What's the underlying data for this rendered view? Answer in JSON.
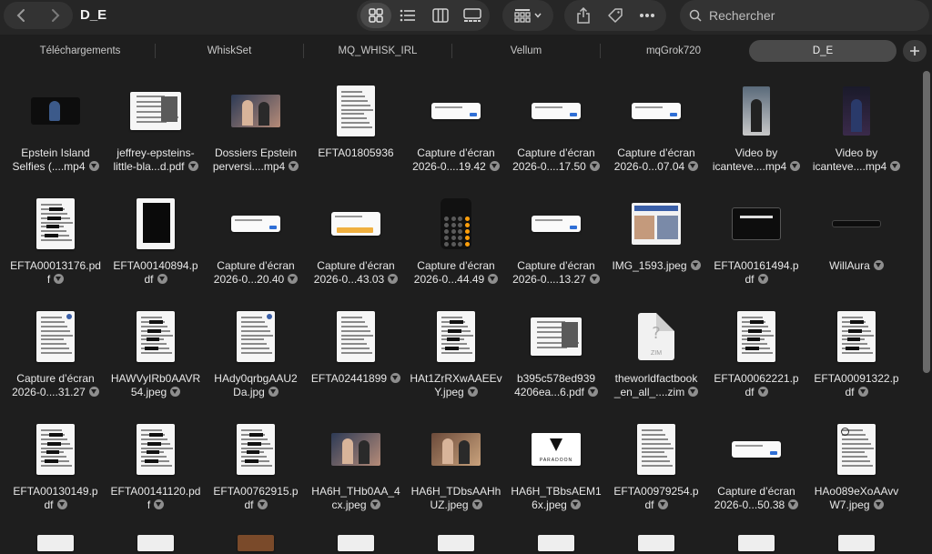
{
  "toolbar": {
    "title": "D_E",
    "search_placeholder": "Rechercher",
    "back_icon": "chevron-left-icon",
    "forward_icon": "chevron-right-icon",
    "views": [
      "icon-view",
      "list-view",
      "column-view",
      "gallery-view"
    ],
    "active_view": "icon-view"
  },
  "tabs": [
    {
      "label": "Téléchargements",
      "active": false
    },
    {
      "label": "WhiskSet",
      "active": false
    },
    {
      "label": "MQ_WHISK_IRL",
      "active": false
    },
    {
      "label": "Vellum",
      "active": false
    },
    {
      "label": "mqGrok720",
      "active": false
    },
    {
      "label": "D_E",
      "active": true
    }
  ],
  "rows": [
    [
      {
        "l1": "Epstein Island",
        "l2": "Selfies (....mp4",
        "cloud": true,
        "kind": "dark-photo"
      },
      {
        "l1": "jeffrey-epsteins-",
        "l2": "little-bla...d.pdf",
        "cloud": true,
        "kind": "doc-wide"
      },
      {
        "l1": "Dossiers Epstein",
        "l2": "perversi....mp4",
        "cloud": true,
        "kind": "photo-people"
      },
      {
        "l1": "EFTA01805936",
        "l2": "",
        "cloud": false,
        "kind": "doc"
      },
      {
        "l1": "Capture d’écran",
        "l2": "2026-0....19.42",
        "cloud": true,
        "kind": "shot"
      },
      {
        "l1": "Capture d’écran",
        "l2": "2026-0....17.50",
        "cloud": true,
        "kind": "shot"
      },
      {
        "l1": "Capture d’écran",
        "l2": "2026-0...07.04",
        "cloud": true,
        "kind": "shot"
      },
      {
        "l1": "Video by",
        "l2": "icanteve....mp4",
        "cloud": true,
        "kind": "phone-video"
      },
      {
        "l1": "Video by",
        "l2": "icanteve....mp4",
        "cloud": true,
        "kind": "phone-video-dark"
      }
    ],
    [
      {
        "l1": "EFTA00013176.pd",
        "l2": "f",
        "cloud": true,
        "kind": "doc-redacted"
      },
      {
        "l1": "EFTA00140894.p",
        "l2": "df",
        "cloud": true,
        "kind": "doc-black"
      },
      {
        "l1": "Capture d’écran",
        "l2": "2026-0...20.40",
        "cloud": true,
        "kind": "shot"
      },
      {
        "l1": "Capture d’écran",
        "l2": "2026-0...43.03",
        "cloud": true,
        "kind": "shot-table"
      },
      {
        "l1": "Capture d’écran",
        "l2": "2026-0...44.49",
        "cloud": true,
        "kind": "calculator"
      },
      {
        "l1": "Capture d’écran",
        "l2": "2026-0....13.27",
        "cloud": true,
        "kind": "shot"
      },
      {
        "l1": "IMG_1593.jpeg",
        "l2": "",
        "cloud": true,
        "kind": "photo-collage"
      },
      {
        "l1": "EFTA00161494.p",
        "l2": "df",
        "cloud": true,
        "kind": "dark-card"
      },
      {
        "l1": "WillAura",
        "l2": "",
        "cloud": true,
        "kind": "dark-strip"
      }
    ],
    [
      {
        "l1": "Capture d’écran",
        "l2": "2026-0....31.27",
        "cloud": true,
        "kind": "doc-list"
      },
      {
        "l1": "HAWVyIRb0AAVR",
        "l2": "54.jpeg",
        "cloud": true,
        "kind": "doc-redacted"
      },
      {
        "l1": "HAdy0qrbgAAU2",
        "l2": "Da.jpg",
        "cloud": true,
        "kind": "doc-list"
      },
      {
        "l1": "EFTA02441899",
        "l2": "",
        "cloud": true,
        "kind": "doc"
      },
      {
        "l1": "HAt1ZrRXwAAEEv",
        "l2": "Y.jpeg",
        "cloud": true,
        "kind": "doc-redacted"
      },
      {
        "l1": "b395c578ed939",
        "l2": "4206ea...6.pdf",
        "cloud": true,
        "kind": "doc-wide"
      },
      {
        "l1": "theworldfactbook",
        "l2": "_en_all_....zim",
        "cloud": true,
        "kind": "zim"
      },
      {
        "l1": "EFTA00062221.p",
        "l2": "df",
        "cloud": true,
        "kind": "doc-redacted"
      },
      {
        "l1": "EFTA00091322.p",
        "l2": "df",
        "cloud": true,
        "kind": "doc-redacted"
      }
    ],
    [
      {
        "l1": "EFTA00130149.p",
        "l2": "df",
        "cloud": true,
        "kind": "doc-redacted"
      },
      {
        "l1": "EFTA00141120.pd",
        "l2": "f",
        "cloud": true,
        "kind": "doc-redacted"
      },
      {
        "l1": "EFTA00762915.p",
        "l2": "df",
        "cloud": true,
        "kind": "doc-redacted"
      },
      {
        "l1": "HA6H_THb0AA_4",
        "l2": "cx.jpeg",
        "cloud": true,
        "kind": "photo-people"
      },
      {
        "l1": "HA6H_TDbsAAHh",
        "l2": "UZ.jpeg",
        "cloud": true,
        "kind": "photo-room"
      },
      {
        "l1": "HA6H_TBbsAEM1",
        "l2": "6x.jpeg",
        "cloud": true,
        "kind": "paradoon"
      },
      {
        "l1": "EFTA00979254.p",
        "l2": "df",
        "cloud": true,
        "kind": "doc"
      },
      {
        "l1": "Capture d’écran",
        "l2": "2026-0...50.38",
        "cloud": true,
        "kind": "shot"
      },
      {
        "l1": "HAo089eXoAAvv",
        "l2": "W7.jpeg",
        "cloud": true,
        "kind": "doc-seal"
      }
    ]
  ],
  "thumb_text": {
    "zim_label": "ZIM",
    "paradoon_label": "PARADOON"
  },
  "colors": {
    "background": "#1e1e1e",
    "toolbar": "#262626",
    "pill": "#333333",
    "active_tab": "#4a4a4a",
    "calc_orange": "#ff9f0a"
  }
}
